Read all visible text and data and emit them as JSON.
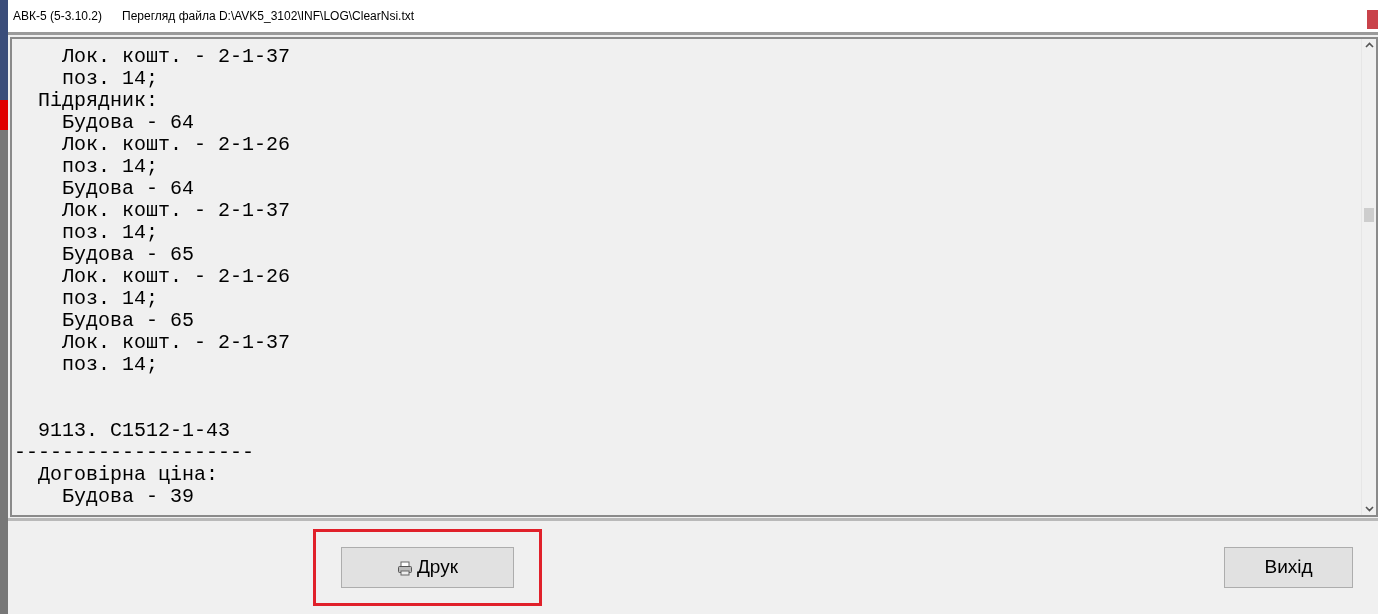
{
  "window": {
    "title": "АВК-5 (5-3.10.2)",
    "subtitle": "Перегляд файла D:\\AVK5_3102\\INF\\LOG\\ClearNsi.txt"
  },
  "text_view": {
    "blocks": [
      [
        "    Лок. кошт. - 2-1-37",
        "    поз. 14;",
        "  Підрядник:",
        "    Будова - 64",
        "    Лок. кошт. - 2-1-26",
        "    поз. 14;",
        "    Будова - 64",
        "    Лок. кошт. - 2-1-37",
        "    поз. 14;",
        "    Будова - 65",
        "    Лок. кошт. - 2-1-26",
        "    поз. 14;",
        "    Будова - 65",
        "    Лок. кошт. - 2-1-37",
        "    поз. 14;"
      ],
      [
        "  9113. С1512-1-43",
        "--------------------",
        "  Договірна ціна:",
        "    Будова - 39"
      ]
    ]
  },
  "buttons": [
    {
      "kind": "print",
      "label": "Друк",
      "highlighted": true
    },
    {
      "kind": "exit",
      "label": "Вихід",
      "highlighted": false
    }
  ]
}
